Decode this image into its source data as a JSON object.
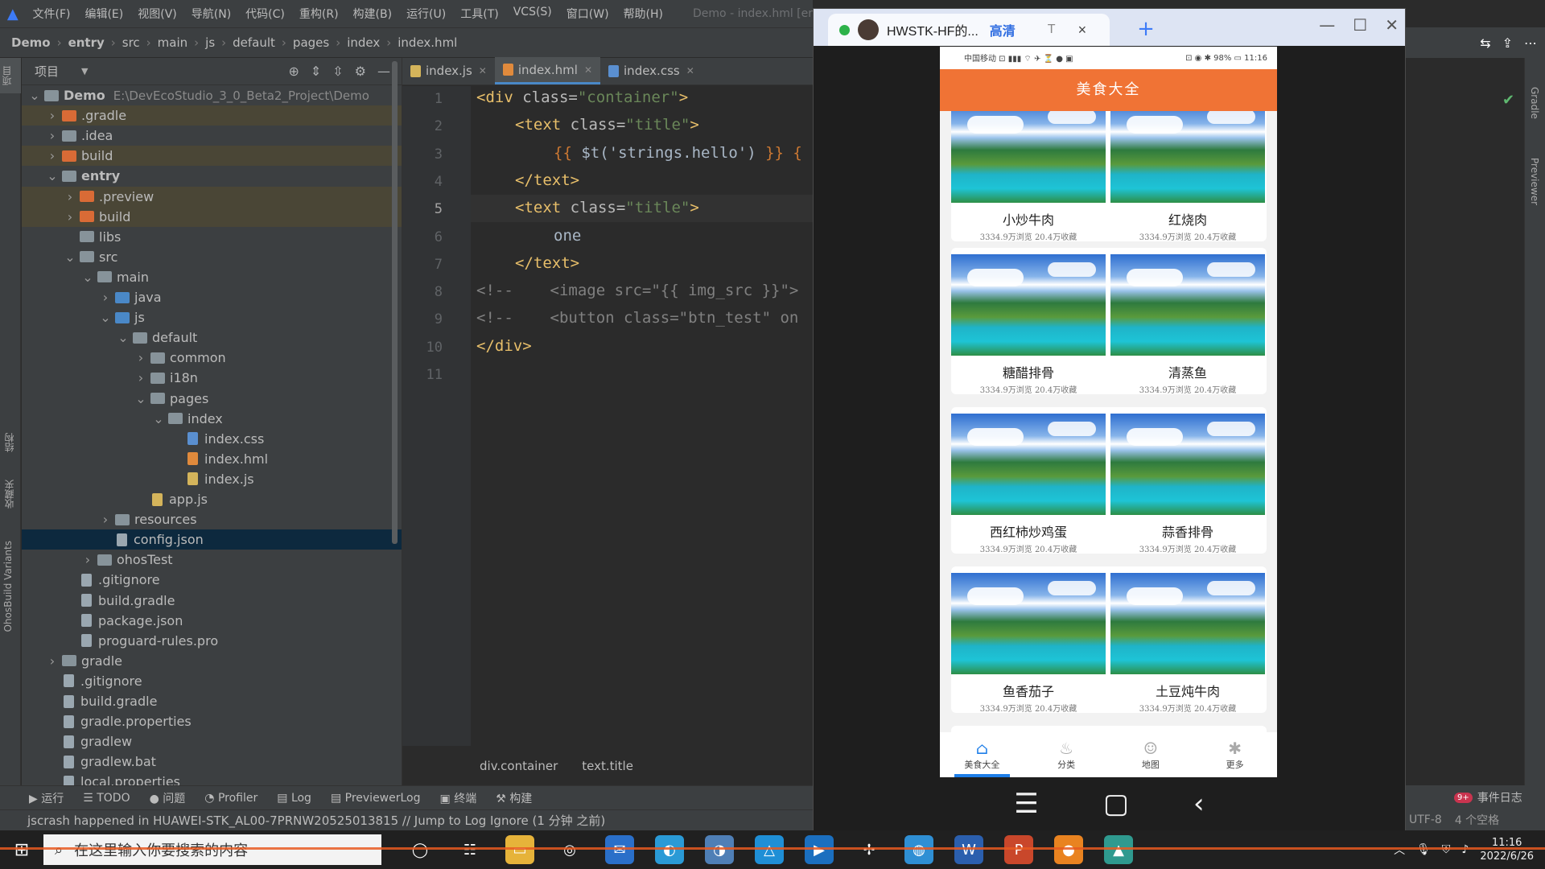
{
  "menubar": {
    "items": [
      "文件(F)",
      "编辑(E)",
      "视图(V)",
      "导航(N)",
      "代码(C)",
      "重构(R)",
      "构建(B)",
      "运行(U)",
      "工具(T)",
      "VCS(S)",
      "窗口(W)",
      "帮助(H)"
    ],
    "title": "Demo - index.hml [er"
  },
  "breadcrumb": [
    "Demo",
    "entry",
    "src",
    "main",
    "js",
    "default",
    "pages",
    "index",
    "index.hml"
  ],
  "left_stripe": {
    "tab1": "项目",
    "tab2": "结构",
    "tab3": "收藏夹",
    "tab4": "OhosBuild Variants"
  },
  "project": {
    "header": "项目",
    "tree": [
      {
        "label": "Demo",
        "path": "E:\\DevEcoStudio_3_0_Beta2_Project\\Demo",
        "depth": 0,
        "open": true,
        "icon": "folder"
      },
      {
        "label": ".gradle",
        "depth": 1,
        "open": false,
        "icon": "folder-orange"
      },
      {
        "label": ".idea",
        "depth": 1,
        "open": false,
        "icon": "folder"
      },
      {
        "label": "build",
        "depth": 1,
        "open": false,
        "icon": "folder-orange"
      },
      {
        "label": "entry",
        "depth": 1,
        "open": true,
        "icon": "folder"
      },
      {
        "label": ".preview",
        "depth": 2,
        "open": false,
        "icon": "folder-orange"
      },
      {
        "label": "build",
        "depth": 2,
        "open": false,
        "icon": "folder-orange"
      },
      {
        "label": "libs",
        "depth": 2,
        "icon": "folder"
      },
      {
        "label": "src",
        "depth": 2,
        "open": true,
        "icon": "folder"
      },
      {
        "label": "main",
        "depth": 3,
        "open": true,
        "icon": "folder"
      },
      {
        "label": "java",
        "depth": 4,
        "open": false,
        "icon": "folder-blue"
      },
      {
        "label": "js",
        "depth": 4,
        "open": true,
        "icon": "folder-blue"
      },
      {
        "label": "default",
        "depth": 5,
        "open": true,
        "icon": "folder"
      },
      {
        "label": "common",
        "depth": 6,
        "open": false,
        "icon": "folder"
      },
      {
        "label": "i18n",
        "depth": 6,
        "open": false,
        "icon": "folder"
      },
      {
        "label": "pages",
        "depth": 6,
        "open": true,
        "icon": "folder"
      },
      {
        "label": "index",
        "depth": 7,
        "open": true,
        "icon": "folder"
      },
      {
        "label": "index.css",
        "depth": 8,
        "icon": "file-css"
      },
      {
        "label": "index.hml",
        "depth": 8,
        "icon": "file-html"
      },
      {
        "label": "index.js",
        "depth": 8,
        "icon": "file-js"
      },
      {
        "label": "app.js",
        "depth": 6,
        "icon": "file-js"
      },
      {
        "label": "resources",
        "depth": 4,
        "open": false,
        "icon": "folder"
      },
      {
        "label": "config.json",
        "depth": 4,
        "icon": "file",
        "selected": true
      },
      {
        "label": "ohosTest",
        "depth": 3,
        "open": false,
        "icon": "folder"
      },
      {
        "label": ".gitignore",
        "depth": 2,
        "icon": "file"
      },
      {
        "label": "build.gradle",
        "depth": 2,
        "icon": "file"
      },
      {
        "label": "package.json",
        "depth": 2,
        "icon": "file"
      },
      {
        "label": "proguard-rules.pro",
        "depth": 2,
        "icon": "file"
      },
      {
        "label": "gradle",
        "depth": 1,
        "open": false,
        "icon": "folder"
      },
      {
        "label": ".gitignore",
        "depth": 1,
        "icon": "file"
      },
      {
        "label": "build.gradle",
        "depth": 1,
        "icon": "file"
      },
      {
        "label": "gradle.properties",
        "depth": 1,
        "icon": "file"
      },
      {
        "label": "gradlew",
        "depth": 1,
        "icon": "file"
      },
      {
        "label": "gradlew.bat",
        "depth": 1,
        "icon": "file"
      },
      {
        "label": "local.properties",
        "depth": 1,
        "icon": "file"
      }
    ]
  },
  "editor": {
    "tabs": [
      {
        "label": "index.js",
        "icon": "file-js",
        "active": false
      },
      {
        "label": "index.hml",
        "icon": "file-html",
        "active": true
      },
      {
        "label": "index.css",
        "icon": "file-css",
        "active": false
      }
    ],
    "current_line": 5,
    "lines": [
      {
        "n": "1",
        "indent": 0,
        "parts": [
          [
            "tag",
            "<div "
          ],
          [
            "attr",
            "class="
          ],
          [
            "str",
            "\"container\""
          ],
          [
            "tag",
            ">"
          ]
        ]
      },
      {
        "n": "2",
        "indent": 1,
        "parts": [
          [
            "tag",
            "<text "
          ],
          [
            "attr",
            "class="
          ],
          [
            "str",
            "\"title\""
          ],
          [
            "tag",
            ">"
          ]
        ]
      },
      {
        "n": "3",
        "indent": 2,
        "parts": [
          [
            "brace",
            "{{ "
          ],
          [
            "plain",
            "$t('strings.hello') "
          ],
          [
            "brace",
            "}} {"
          ]
        ]
      },
      {
        "n": "4",
        "indent": 1,
        "parts": [
          [
            "tag",
            "</text>"
          ]
        ]
      },
      {
        "n": "5",
        "indent": 1,
        "parts": [
          [
            "tag",
            "<text "
          ],
          [
            "attr",
            "class="
          ],
          [
            "str",
            "\"title\""
          ],
          [
            "tag",
            ">"
          ]
        ]
      },
      {
        "n": "6",
        "indent": 2,
        "parts": [
          [
            "plain",
            "one"
          ]
        ]
      },
      {
        "n": "7",
        "indent": 1,
        "parts": [
          [
            "tag",
            "</text>"
          ]
        ]
      },
      {
        "n": "8",
        "indent": 0,
        "parts": [
          [
            "cmt",
            "<!--    <image src=\"{{ img_src }}\">"
          ]
        ]
      },
      {
        "n": "9",
        "indent": 0,
        "parts": [
          [
            "cmt",
            "<!--    <button class=\"btn_test\" on"
          ]
        ]
      },
      {
        "n": "10",
        "indent": 0,
        "parts": [
          [
            "tag",
            "</div>"
          ]
        ]
      },
      {
        "n": "11",
        "indent": 0,
        "parts": []
      }
    ],
    "breadcrumb": [
      "div.container",
      "text.title"
    ]
  },
  "previewer": {
    "tab_title": "HWSTK-HF的...",
    "quality": "高清",
    "tab_t": "T",
    "close": "×",
    "plus": "+",
    "window_buttons": [
      "—",
      "☐",
      "✕"
    ]
  },
  "phone": {
    "status_left": "中国移动 ⊡ ▮▮▮ ⌔ ✈ ⏳ ● ▣",
    "status_right": "⊡ ◉ ✱ 98% ▭ 11:16",
    "app_title": "美食大全",
    "items": [
      {
        "name": "小炒牛肉",
        "meta": "3334.9万浏览 20.4万收藏"
      },
      {
        "name": "红烧肉",
        "meta": "3334.9万浏览 20.4万收藏"
      },
      {
        "name": "糖醋排骨",
        "meta": "3334.9万浏览 20.4万收藏"
      },
      {
        "name": "清蒸鱼",
        "meta": "3334.9万浏览 20.4万收藏"
      },
      {
        "name": "西红柿炒鸡蛋",
        "meta": "3334.9万浏览 20.4万收藏"
      },
      {
        "name": "蒜香排骨",
        "meta": "3334.9万浏览 20.4万收藏"
      },
      {
        "name": "鱼香茄子",
        "meta": "3334.9万浏览 20.4万收藏"
      },
      {
        "name": "土豆炖牛肉",
        "meta": "3334.9万浏览 20.4万收藏"
      },
      {
        "name": "",
        "meta": ""
      },
      {
        "name": "",
        "meta": ""
      }
    ],
    "nav": [
      {
        "label": "美食大全",
        "icon": "home-icon",
        "glyph": "⌂",
        "active": true
      },
      {
        "label": "分类",
        "icon": "flame-icon",
        "glyph": "♨",
        "active": false
      },
      {
        "label": "地图",
        "icon": "person-icon",
        "glyph": "☺",
        "active": false
      },
      {
        "label": "更多",
        "icon": "pinwheel-icon",
        "glyph": "✱",
        "active": false
      }
    ],
    "system_nav": [
      "☰",
      "▢",
      "‹"
    ]
  },
  "toolwindows": {
    "items": [
      "运行",
      "TODO",
      "问题",
      "Profiler",
      "Log",
      "PreviewerLog",
      "终端",
      "构建"
    ],
    "event_log": "事件日志",
    "event_badge": "9+"
  },
  "statusbar": {
    "message": "jscrash happened in HUAWEI-STK_AL00-7PRNW20525013815 // Jump to Log   Ignore (1 分钟 之前)",
    "encoding": "UTF-8",
    "spaces": "4 个空格"
  },
  "right_stripe": {
    "tab1": "Gradle",
    "tab2": "Previewer"
  },
  "taskbar": {
    "search_placeholder": "在这里输入你要搜索的内容",
    "time": "11:16",
    "date": "2022/6/26"
  }
}
